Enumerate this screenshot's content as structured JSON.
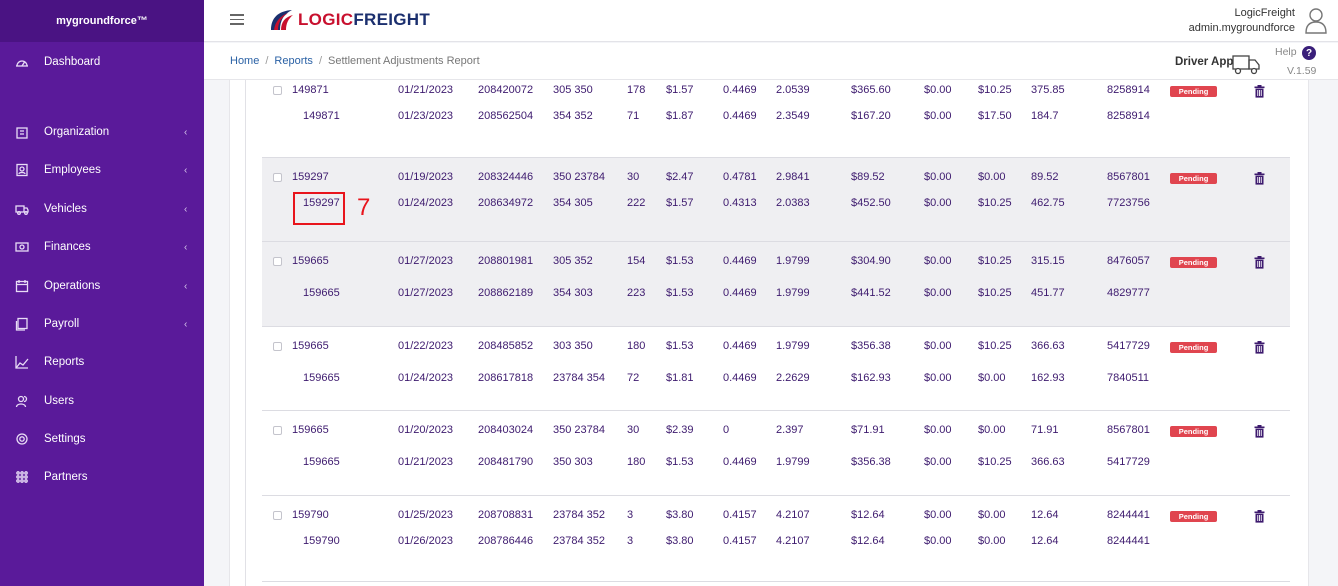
{
  "sidebar": {
    "brand": "mygroundforce™",
    "items": [
      {
        "label": "Dashboard",
        "icon": "dashboard-icon",
        "chevron": false
      },
      {
        "label": "Organization",
        "icon": "organization-icon",
        "chevron": true
      },
      {
        "label": "Employees",
        "icon": "employees-icon",
        "chevron": true
      },
      {
        "label": "Vehicles",
        "icon": "vehicles-icon",
        "chevron": true
      },
      {
        "label": "Finances",
        "icon": "finances-icon",
        "chevron": true
      },
      {
        "label": "Operations",
        "icon": "operations-icon",
        "chevron": true
      },
      {
        "label": "Payroll",
        "icon": "payroll-icon",
        "chevron": true
      },
      {
        "label": "Reports",
        "icon": "reports-icon",
        "chevron": false
      },
      {
        "label": "Users",
        "icon": "users-icon",
        "chevron": false
      },
      {
        "label": "Settings",
        "icon": "settings-icon",
        "chevron": false
      },
      {
        "label": "Partners",
        "icon": "partners-icon",
        "chevron": false
      }
    ]
  },
  "header": {
    "logo_part1": "LOGIC",
    "logo_part2": "FREIGHT",
    "user_name": "LogicFreight",
    "user_email": "admin.mygroundforce"
  },
  "breadcrumb": {
    "home": "Home",
    "reports": "Reports",
    "current": "Settlement Adjustments Report"
  },
  "toolbar": {
    "driver_app": "Driver App",
    "help": "Help",
    "version": "V.1.59"
  },
  "annotation": {
    "number": "7"
  },
  "status_label": "Pending",
  "groups": [
    {
      "shaded": false,
      "rows": [
        [
          "149871",
          "01/21/2023",
          "208420072",
          "305 350",
          "178",
          "$1.57",
          "0.4469",
          "2.0539",
          "$365.60",
          "$0.00",
          "$10.25",
          "375.85",
          "8258914"
        ],
        [
          "149871",
          "01/23/2023",
          "208562504",
          "354 352",
          "71",
          "$1.87",
          "0.4469",
          "2.3549",
          "$167.20",
          "$0.00",
          "$17.50",
          "184.7",
          "8258914"
        ]
      ]
    },
    {
      "shaded": true,
      "rows": [
        [
          "159297",
          "01/19/2023",
          "208324446",
          "350 23784",
          "30",
          "$2.47",
          "0.4781",
          "2.9841",
          "$89.52",
          "$0.00",
          "$0.00",
          "89.52",
          "8567801"
        ],
        [
          "159297",
          "01/24/2023",
          "208634972",
          "354 305",
          "222",
          "$1.57",
          "0.4313",
          "2.0383",
          "$452.50",
          "$0.00",
          "$10.25",
          "462.75",
          "7723756"
        ]
      ]
    },
    {
      "shaded": true,
      "rows": [
        [
          "159665",
          "01/27/2023",
          "208801981",
          "305 352",
          "154",
          "$1.53",
          "0.4469",
          "1.9799",
          "$304.90",
          "$0.00",
          "$10.25",
          "315.15",
          "8476057"
        ],
        [
          "159665",
          "01/27/2023",
          "208862189",
          "354 303",
          "223",
          "$1.53",
          "0.4469",
          "1.9799",
          "$441.52",
          "$0.00",
          "$10.25",
          "451.77",
          "4829777"
        ]
      ]
    },
    {
      "shaded": false,
      "rows": [
        [
          "159665",
          "01/22/2023",
          "208485852",
          "303 350",
          "180",
          "$1.53",
          "0.4469",
          "1.9799",
          "$356.38",
          "$0.00",
          "$10.25",
          "366.63",
          "5417729"
        ],
        [
          "159665",
          "01/24/2023",
          "208617818",
          "23784 354",
          "72",
          "$1.81",
          "0.4469",
          "2.2629",
          "$162.93",
          "$0.00",
          "$0.00",
          "162.93",
          "7840511"
        ]
      ]
    },
    {
      "shaded": false,
      "rows": [
        [
          "159665",
          "01/20/2023",
          "208403024",
          "350 23784",
          "30",
          "$2.39",
          "0",
          "2.397",
          "$71.91",
          "$0.00",
          "$0.00",
          "71.91",
          "8567801"
        ],
        [
          "159665",
          "01/21/2023",
          "208481790",
          "350 303",
          "180",
          "$1.53",
          "0.4469",
          "1.9799",
          "$356.38",
          "$0.00",
          "$10.25",
          "366.63",
          "5417729"
        ]
      ]
    },
    {
      "shaded": false,
      "rows": [
        [
          "159790",
          "01/25/2023",
          "208708831",
          "23784 352",
          "3",
          "$3.80",
          "0.4157",
          "4.2107",
          "$12.64",
          "$0.00",
          "$0.00",
          "12.64",
          "8244441"
        ],
        [
          "159790",
          "01/26/2023",
          "208786446",
          "23784 352",
          "3",
          "$3.80",
          "0.4157",
          "4.2107",
          "$12.64",
          "$0.00",
          "$0.00",
          "12.64",
          "8244441"
        ]
      ]
    }
  ]
}
